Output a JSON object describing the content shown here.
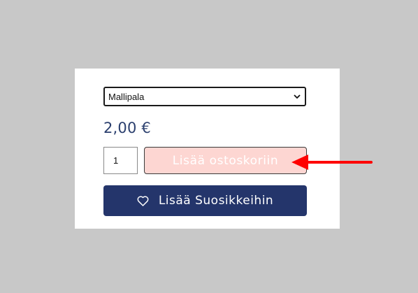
{
  "product": {
    "variant_selected": "Mallipala",
    "price": "2,00 €",
    "quantity": "1",
    "add_to_cart_label": "Lisää ostoskoriin",
    "add_to_favorites_label": "Lisää Suosikkeihin"
  },
  "icons": {
    "select_chevron": "chevron-down-icon",
    "favorites": "heart-icon",
    "annotation": "red-arrow-icon"
  },
  "colors": {
    "background": "#c8c8c8",
    "card": "#ffffff",
    "price_text": "#2b3f6e",
    "add_to_cart_bg": "#fdd6d2",
    "favorites_bg": "#24356b",
    "annotation_arrow": "#ff0000"
  }
}
